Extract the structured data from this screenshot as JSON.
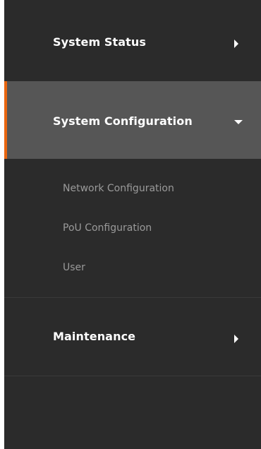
{
  "sidebar": {
    "accent_color": "#e8650f",
    "items": [
      {
        "label": "System Status",
        "icon": "chevron-right-icon",
        "expanded": false
      },
      {
        "label": "System Configuration",
        "icon": "chevron-down-icon",
        "expanded": true,
        "active": true,
        "children": [
          {
            "label": "Network Configuration"
          },
          {
            "label": "PoU Configuration"
          },
          {
            "label": "User"
          }
        ]
      },
      {
        "label": "Maintenance",
        "icon": "chevron-right-icon",
        "expanded": false
      }
    ]
  }
}
